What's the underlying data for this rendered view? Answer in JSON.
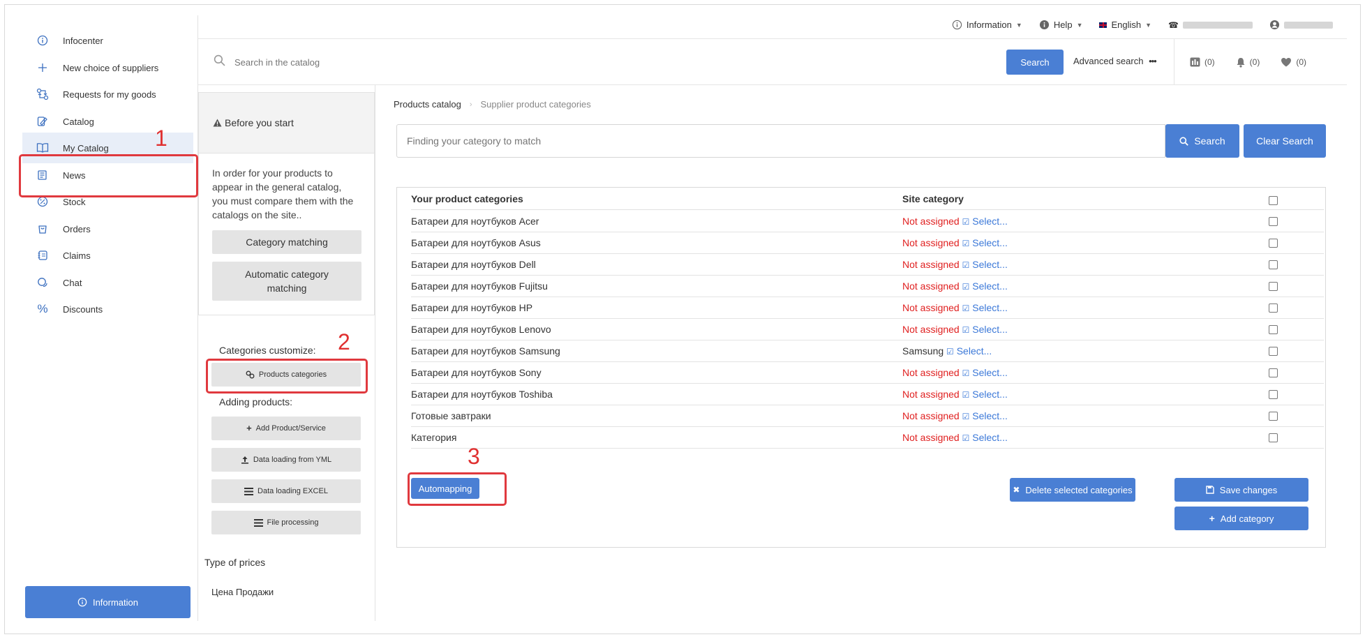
{
  "sidebar": {
    "items": [
      {
        "label": "Infocenter",
        "icon": "info-icon"
      },
      {
        "label": "New choice of suppliers",
        "icon": "plus-icon"
      },
      {
        "label": "Requests for my goods",
        "icon": "exchange-icon"
      },
      {
        "label": "Catalog",
        "icon": "catalog-icon"
      },
      {
        "label": "My Catalog",
        "icon": "book-icon"
      },
      {
        "label": "News",
        "icon": "news-icon"
      },
      {
        "label": "Stock",
        "icon": "percent-circle-icon"
      },
      {
        "label": "Orders",
        "icon": "bag-icon"
      },
      {
        "label": "Claims",
        "icon": "claims-icon"
      },
      {
        "label": "Chat",
        "icon": "chat-icon"
      },
      {
        "label": "Discounts",
        "icon": "percent-icon"
      }
    ],
    "info_button": "Information"
  },
  "topbar": {
    "information": "Information",
    "help": "Help",
    "language": "English"
  },
  "search": {
    "placeholder": "Search in the catalog",
    "button": "Search",
    "advanced": "Advanced search",
    "compare_count": "(0)",
    "notif_count": "(0)",
    "fav_count": "(0)"
  },
  "panel": {
    "before_start": "Before you start",
    "intro": "In order for your products to appear in the general catalog, you must compare them with the catalogs on the site..",
    "category_matching": "Category matching",
    "auto_matching": "Automatic category matching",
    "customize_label": "Categories customize:",
    "products_categories": "Products categories",
    "adding_label": "Adding products:",
    "add_product": "Add Product/Service",
    "yml": "Data loading from YML",
    "excel": "Data loading EXCEL",
    "file_processing": "File processing",
    "price_types": "Type of prices",
    "price_value": "Цена Продажи"
  },
  "main": {
    "breadcrumb_root": "Products catalog",
    "breadcrumb_current": "Supplier product categories",
    "cat_search_placeholder": "Finding your category to match",
    "search_btn": "Search",
    "clear_btn": "Clear Search",
    "col_yours": "Your product categories",
    "col_site": "Site category",
    "select_label": "Select...",
    "rows": [
      {
        "name": "Батареи для ноутбуков Acer",
        "site": "Not assigned",
        "assigned": false
      },
      {
        "name": "Батареи для ноутбуков Asus",
        "site": "Not assigned",
        "assigned": false
      },
      {
        "name": "Батареи для ноутбуков Dell",
        "site": "Not assigned",
        "assigned": false
      },
      {
        "name": "Батареи для ноутбуков Fujitsu",
        "site": "Not assigned",
        "assigned": false
      },
      {
        "name": "Батареи для ноутбуков HP",
        "site": "Not assigned",
        "assigned": false
      },
      {
        "name": "Батареи для ноутбуков Lenovo",
        "site": "Not assigned",
        "assigned": false
      },
      {
        "name": "Батареи для ноутбуков Samsung",
        "site": "Samsung",
        "assigned": true
      },
      {
        "name": "Батареи для ноутбуков Sony",
        "site": "Not assigned",
        "assigned": false
      },
      {
        "name": "Батареи для ноутбуков Toshiba",
        "site": "Not assigned",
        "assigned": false
      },
      {
        "name": "Готовые завтраки",
        "site": "Not assigned",
        "assigned": false
      },
      {
        "name": "Категория",
        "site": "Not assigned",
        "assigned": false
      }
    ],
    "automapping": "Automapping",
    "delete_selected": "Delete selected categories",
    "save_changes": "Save changes",
    "add_category": "Add category"
  },
  "annotations": {
    "n1": "1",
    "n2": "2",
    "n3": "3"
  },
  "colors": {
    "accent": "#4a7fd4",
    "not_assigned": "#e02020",
    "annotation": "#e0393e"
  }
}
